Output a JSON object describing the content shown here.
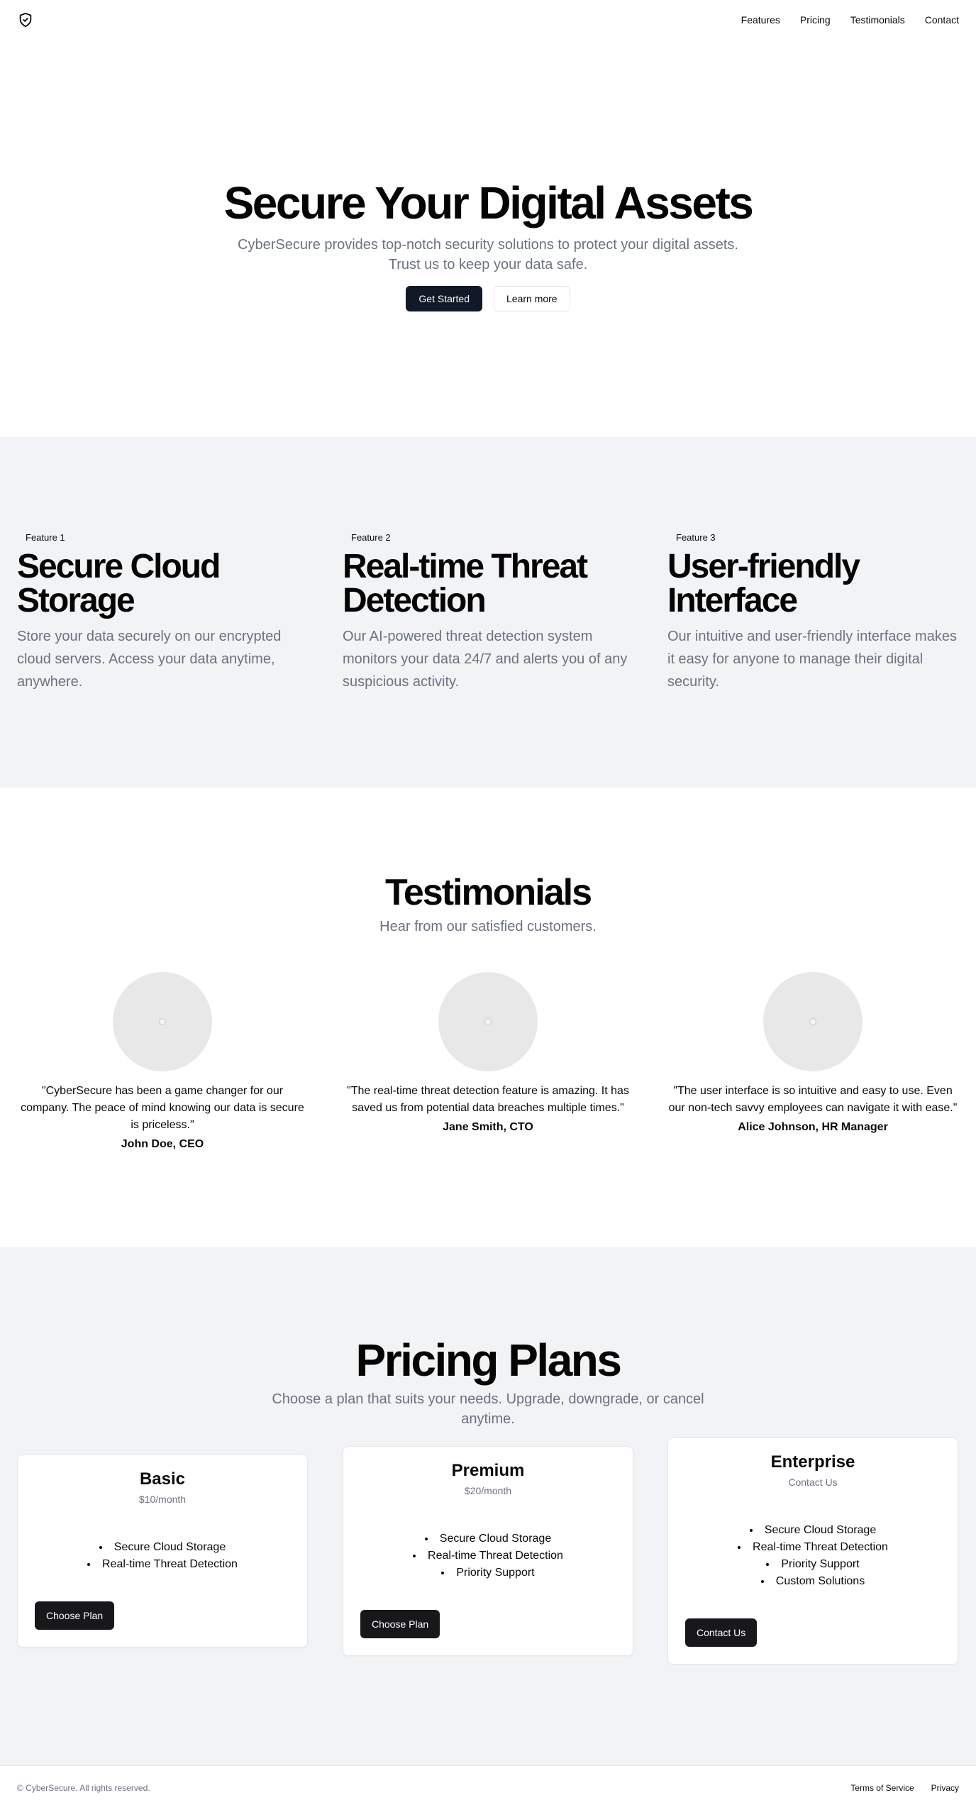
{
  "nav": {
    "logo_icon": "shield-check-icon",
    "links": [
      "Features",
      "Pricing",
      "Testimonials",
      "Contact"
    ]
  },
  "hero": {
    "title": "Secure Your Digital Assets",
    "subtitle": "CyberSecure provides top-notch security solutions to protect your digital assets. Trust us to keep your data safe.",
    "primary_button": "Get Started",
    "secondary_button": "Learn more"
  },
  "features": [
    {
      "badge": "Feature 1",
      "title": "Secure Cloud Storage",
      "text": "Store your data securely on our encrypted cloud servers. Access your data anytime, anywhere."
    },
    {
      "badge": "Feature 2",
      "title": "Real-time Threat Detection",
      "text": "Our AI-powered threat detection system monitors your data 24/7 and alerts you of any suspicious activity."
    },
    {
      "badge": "Feature 3",
      "title": "User-friendly Interface",
      "text": "Our intuitive and user-friendly interface makes it easy for anyone to manage their digital security."
    }
  ],
  "testimonials": {
    "title": "Testimonials",
    "subtitle": "Hear from our satisfied customers.",
    "items": [
      {
        "quote": "\"CyberSecure has been a game changer for our company. The peace of mind knowing our data is secure is priceless.\"",
        "author": "John Doe, CEO"
      },
      {
        "quote": "\"The real-time threat detection feature is amazing. It has saved us from potential data breaches multiple times.\"",
        "author": "Jane Smith, CTO"
      },
      {
        "quote": "\"The user interface is so intuitive and easy to use. Even our non-tech savvy employees can navigate it with ease.\"",
        "author": "Alice Johnson, HR Manager"
      }
    ]
  },
  "pricing": {
    "title": "Pricing Plans",
    "subtitle": "Choose a plan that suits your needs. Upgrade, downgrade, or cancel anytime.",
    "plans": [
      {
        "name": "Basic",
        "price": "$10/month",
        "features": [
          "Secure Cloud Storage",
          "Real-time Threat Detection"
        ],
        "button": "Choose Plan"
      },
      {
        "name": "Premium",
        "price": "$20/month",
        "features": [
          "Secure Cloud Storage",
          "Real-time Threat Detection",
          "Priority Support"
        ],
        "button": "Choose Plan"
      },
      {
        "name": "Enterprise",
        "price": "Contact Us",
        "features": [
          "Secure Cloud Storage",
          "Real-time Threat Detection",
          "Priority Support",
          "Custom Solutions"
        ],
        "button": "Contact Us"
      }
    ]
  },
  "footer": {
    "copyright": "© CyberSecure. All rights reserved.",
    "links": [
      "Terms of Service",
      "Privacy"
    ]
  }
}
